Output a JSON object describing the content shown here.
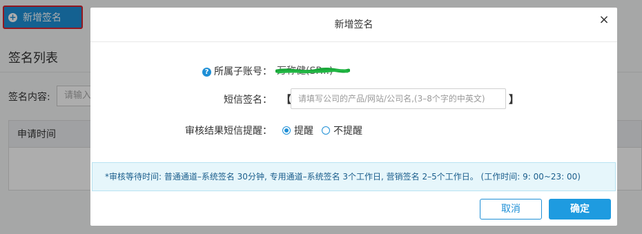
{
  "background": {
    "add_button_label": "新增签名",
    "list_title": "签名列表",
    "filter_label": "签名内容:",
    "filter_placeholder": "请输入",
    "table_header_col1": "申请时间"
  },
  "modal": {
    "title": "新增签名",
    "close_label": "×",
    "account_label": "所属子账号：",
    "account_value": "万称健(SP...)",
    "sign_label": "短信签名：",
    "bracket_left": "【",
    "bracket_right": "】",
    "sign_placeholder": "请填写公司的产品/网站/公司名,(3–8个字的中英文)",
    "sms_notify_label": "审核结果短信提醒：",
    "radio_on_label": "提醒",
    "radio_off_label": "不提醒",
    "notice": "*审核等待时间: 普通通道–系统签名 30分钟, 专用通道–系统签名 3个工作日, 营销签名 2–5个工作日。 (工作时间: 9: 00~23: 00)",
    "cancel_label": "取消",
    "confirm_label": "确定"
  },
  "colors": {
    "accent": "#1e8fd6",
    "highlight_border": "#d9232e",
    "scribble": "#1aa83a"
  },
  "icons": {
    "plus": "plus-circle-icon",
    "help": "question-circle-icon",
    "close": "close-icon"
  }
}
